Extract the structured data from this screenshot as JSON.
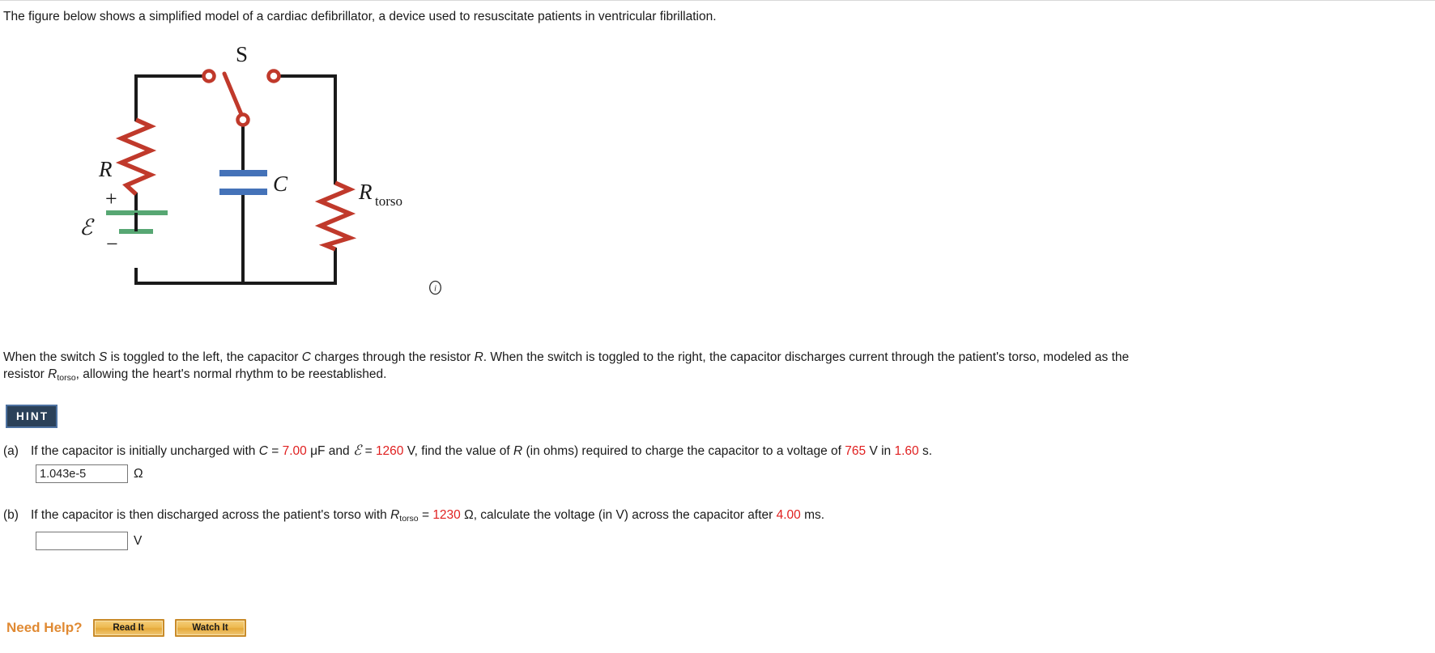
{
  "intro": "The figure below shows a simplified model of a cardiac defibrillator, a device used to resuscitate patients in ventricular fibrillation.",
  "figure": {
    "labels": {
      "switch": "S",
      "resistor": "R",
      "capacitor": "C",
      "torso_resistor": "R",
      "torso_subscript": "torso",
      "emf": "ℰ",
      "plus": "+",
      "minus": "−"
    },
    "colors": {
      "wire": "#1a1a1a",
      "resistor": "#c0392b",
      "switch": "#c0392b",
      "capacitor": "#4472b8",
      "battery": "#57a773"
    },
    "info_icon": "info-circle-icon"
  },
  "body": {
    "line1": "When the switch S is toggled to the left, the capacitor C charges through the resistor R. When the switch is toggled to the right, the capacitor discharges current through the patient's torso, modeled as the",
    "line2_pre": "resistor ",
    "line2_var": "R",
    "line2_sub": "torso",
    "line2_post": ", allowing the heart's normal rhythm to be reestablished."
  },
  "hint": {
    "label": "HINT",
    "bg": "#2b4159",
    "border": "#4e72a1"
  },
  "parts": [
    {
      "label": "(a)",
      "text_1": "If the capacitor is initially uncharged with ",
      "var_C": "C",
      "eq1": " = ",
      "val_C": "7.00",
      "unit_C": " μF and ",
      "emf": "ℰ",
      "eq2": " = ",
      "val_emf": "1260",
      "text_2": " V, find the value of ",
      "var_R": "R",
      "text_3": " (in ohms) required to charge the capacitor to a voltage of ",
      "val_V": "765",
      "text_4": " V in ",
      "val_t": "1.60",
      "text_5": " s.",
      "answer_value": "1.043e-5",
      "answer_placeholder": "",
      "answer_unit": "Ω"
    },
    {
      "label": "(b)",
      "text_1": "If the capacitor is then discharged across the patient's torso with ",
      "var_R": "R",
      "var_R_sub": "torso",
      "eq1": " = ",
      "val_R": "1230",
      "unit_R": " Ω, calculate the voltage (in V) across the capacitor after ",
      "val_t": "4.00",
      "text_2": " ms.",
      "answer_value": "",
      "answer_placeholder": "",
      "answer_unit": "V"
    }
  ],
  "need_help": {
    "label": "Need Help?",
    "buttons": [
      {
        "label": "Read It"
      },
      {
        "label": "Watch It"
      }
    ],
    "label_color": "#e08a33"
  }
}
